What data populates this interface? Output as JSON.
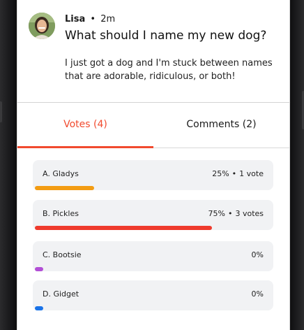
{
  "post": {
    "author": "Lisa",
    "separator": "•",
    "time": "2m",
    "title": "What should I name my new dog?",
    "body": "I just got a dog and I'm stuck between names that are adorable, ridiculous, or both!"
  },
  "tabs": [
    {
      "label": "Votes (4)",
      "active": true
    },
    {
      "label": "Comments (2)",
      "active": false
    }
  ],
  "poll": {
    "options": [
      {
        "label": "A. Gladys",
        "percent": "25%",
        "dot": "•",
        "votes": "1 vote",
        "fraction": 0.25,
        "color": "#f39c12"
      },
      {
        "label": "B. Pickles",
        "percent": "75%",
        "dot": "•",
        "votes": "3 votes",
        "fraction": 0.75,
        "color": "#ef3b2d"
      },
      {
        "label": "C. Bootsie",
        "percent": "0%",
        "fraction": 0.0,
        "color": "#b24fd6"
      },
      {
        "label": "D. Gidget",
        "percent": "0%",
        "fraction": 0.0,
        "color": "#1a73e8"
      }
    ]
  },
  "colors": {
    "accent": "#f14a2e"
  }
}
